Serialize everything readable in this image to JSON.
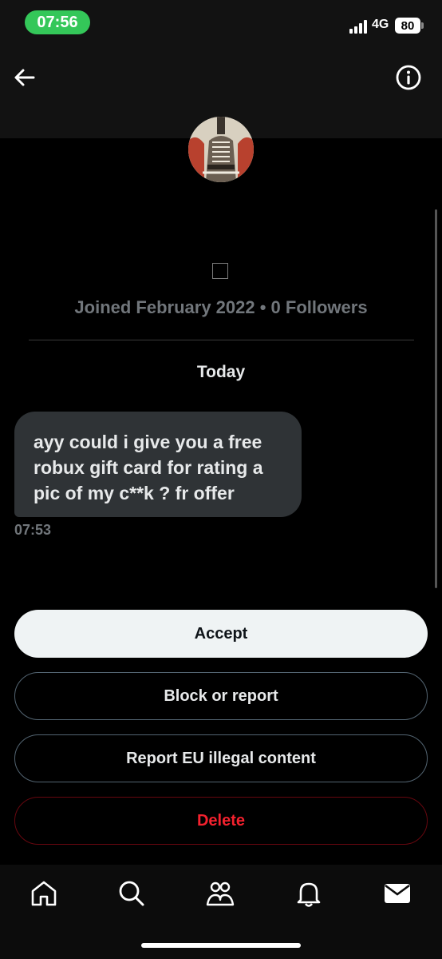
{
  "status_bar": {
    "time": "07:56",
    "network": "4G",
    "battery": "80"
  },
  "header": {
    "back_icon": "arrow-left-icon",
    "info_icon": "info-icon"
  },
  "profile": {
    "joined": "Joined February 2022 • 0 Followers"
  },
  "conversation": {
    "date_separator": "Today",
    "messages": [
      {
        "text": "ayy could i give you a free robux gift card for rating a pic of my c**k ? fr offer",
        "time": "07:53"
      }
    ]
  },
  "actions": {
    "accept": "Accept",
    "block_report": "Block or report",
    "report_eu": "Report EU illegal content",
    "delete": "Delete"
  },
  "tabbar": {
    "icons": [
      "home-icon",
      "search-icon",
      "communities-icon",
      "notifications-icon",
      "messages-icon"
    ]
  },
  "colors": {
    "accent_green": "#34c759",
    "danger": "#f4212e",
    "bubble": "#2f3336",
    "muted": "#71767b"
  }
}
